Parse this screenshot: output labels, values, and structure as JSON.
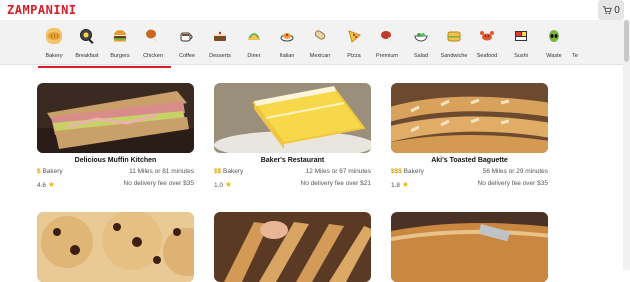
{
  "header": {
    "logo": "ZAMPANINI",
    "cart_count": "0"
  },
  "categories": [
    {
      "label": "Bakery",
      "icon": "bread-icon"
    },
    {
      "label": "Breakfast",
      "icon": "pan-icon"
    },
    {
      "label": "Burgers",
      "icon": "burger-icon"
    },
    {
      "label": "Chicken",
      "icon": "drumstick-icon"
    },
    {
      "label": "Coffee",
      "icon": "coffee-icon"
    },
    {
      "label": "Desserts",
      "icon": "cake-icon"
    },
    {
      "label": "Diner",
      "icon": "taco-icon"
    },
    {
      "label": "Italian",
      "icon": "spaghetti-icon"
    },
    {
      "label": "Mexican",
      "icon": "burrito-icon"
    },
    {
      "label": "Pizza",
      "icon": "pizza-icon"
    },
    {
      "label": "Premium",
      "icon": "meat-icon"
    },
    {
      "label": "Salad",
      "icon": "salad-icon"
    },
    {
      "label": "Sandwiche",
      "icon": "sandwich-icon"
    },
    {
      "label": "Seafood",
      "icon": "crab-icon"
    },
    {
      "label": "Sushi",
      "icon": "bento-icon"
    },
    {
      "label": "Waste",
      "icon": "alien-icon"
    },
    {
      "label": "Te",
      "icon": "cup-icon"
    }
  ],
  "cards": [
    {
      "name": "Delicious Muffin Kitchen",
      "category": "Bakery",
      "price": "$",
      "distance": "11 Miles or 81 minutes",
      "rating": "4.6",
      "delivery": "No delivery fee over $35"
    },
    {
      "name": "Baker's Restaurant",
      "category": "Bakery",
      "price": "$$",
      "distance": "12 Miles or 67 minutes",
      "rating": "1.0",
      "delivery": "No delivery fee over $21"
    },
    {
      "name": "Aki's Toasted Baguette",
      "category": "Bakery",
      "price": "$$$",
      "distance": "56 Miles or 29 minutes",
      "rating": "1.8",
      "delivery": "No delivery fee over $35"
    },
    {
      "name": "",
      "category": "",
      "price": "",
      "distance": "",
      "rating": "",
      "delivery": ""
    },
    {
      "name": "",
      "category": "",
      "price": "",
      "distance": "",
      "rating": "",
      "delivery": ""
    },
    {
      "name": "",
      "category": "",
      "price": "",
      "distance": "",
      "rating": "",
      "delivery": ""
    }
  ]
}
